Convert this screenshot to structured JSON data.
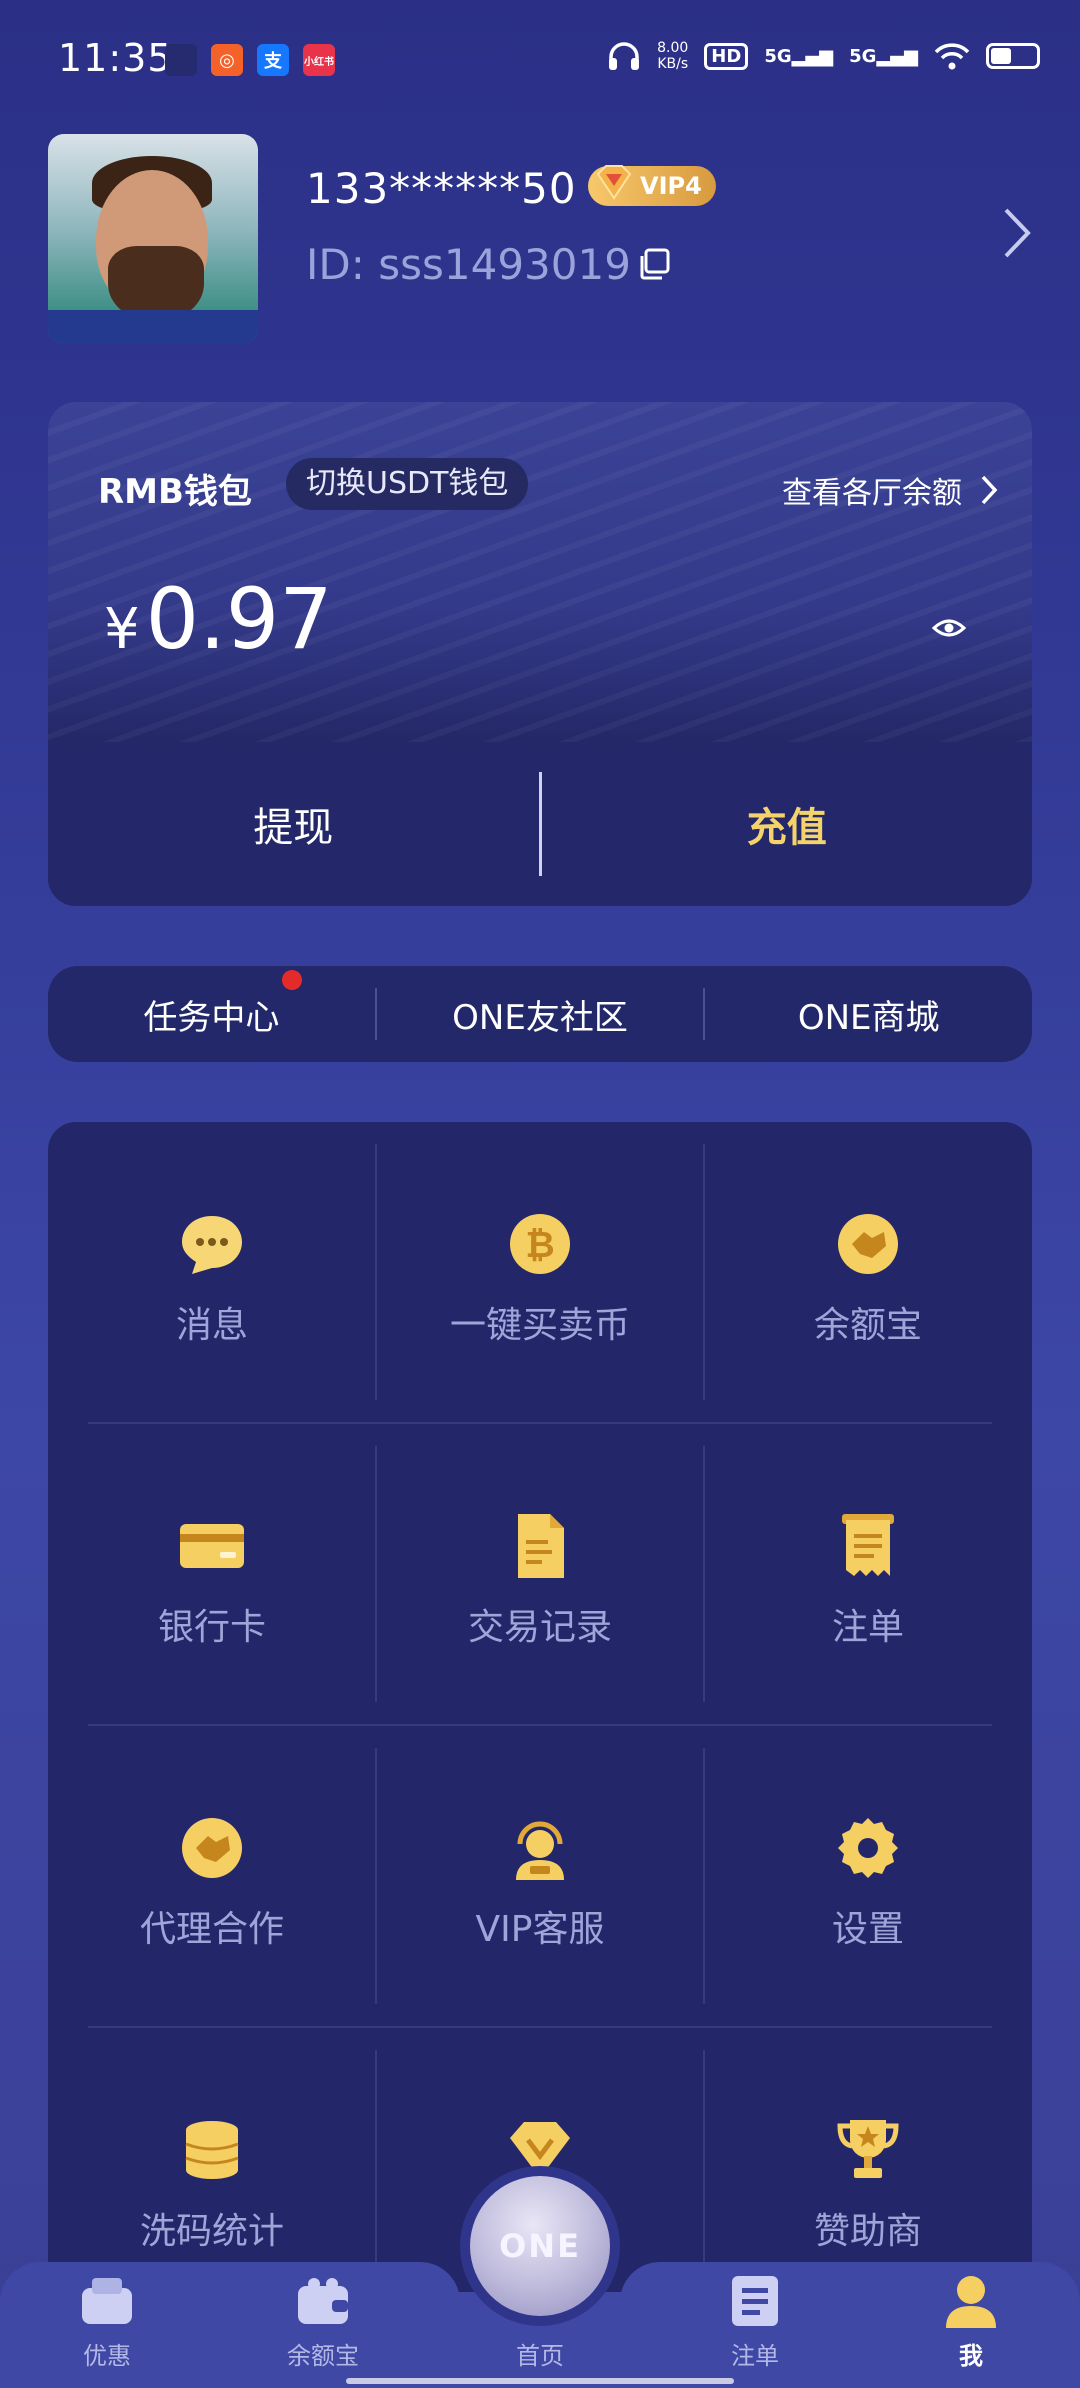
{
  "status_bar": {
    "time": "11:35",
    "speed_value": "8.00",
    "speed_unit": "KB/s",
    "hd_label": "HD",
    "sim1_label": "5G",
    "sim2_label": "5G",
    "app_icons": [
      "app-icon",
      "podcast-icon",
      "alipay-icon",
      "xiaohongshu-icon"
    ],
    "battery_level": 0.45
  },
  "profile": {
    "username": "133******50",
    "vip_label": "VIP4",
    "user_id": "ID: sss1493019"
  },
  "wallet": {
    "title": "RMB钱包",
    "switch_label": "切换USDT钱包",
    "view_balances_label": "查看各厅余额",
    "currency_symbol": "¥",
    "balance": "0.97",
    "withdraw_label": "提现",
    "recharge_label": "充值",
    "accent_color": "#f4d36a"
  },
  "quick_links": [
    {
      "label": "任务中心",
      "has_dot": true
    },
    {
      "label": "ONE友社区",
      "has_dot": false
    },
    {
      "label": "ONE商城",
      "has_dot": false
    }
  ],
  "grid_items": [
    {
      "label": "消息",
      "icon": "message-icon"
    },
    {
      "label": "一键买卖币",
      "icon": "bitcoin-icon"
    },
    {
      "label": "余额宝",
      "icon": "handshake-icon"
    },
    {
      "label": "银行卡",
      "icon": "bank-card-icon"
    },
    {
      "label": "交易记录",
      "icon": "document-icon"
    },
    {
      "label": "注单",
      "icon": "receipt-icon"
    },
    {
      "label": "代理合作",
      "icon": "handshake-icon"
    },
    {
      "label": "VIP客服",
      "icon": "headset-agent-icon"
    },
    {
      "label": "设置",
      "icon": "gear-icon"
    },
    {
      "label": "洗码统计",
      "icon": "coin-stack-icon"
    },
    {
      "label": "",
      "icon": "diamond-icon"
    },
    {
      "label": "赞助商",
      "icon": "trophy-icon"
    }
  ],
  "bottom_nav": {
    "items": [
      {
        "label": "优惠",
        "icon": "wallet-promo-icon"
      },
      {
        "label": "余额宝",
        "icon": "purse-icon"
      },
      {
        "label": "首页",
        "icon": "home-orb-icon"
      },
      {
        "label": "注单",
        "icon": "list-icon"
      },
      {
        "label": "我",
        "icon": "user-icon"
      }
    ],
    "orb_text": "ONE",
    "active_index": 4
  }
}
